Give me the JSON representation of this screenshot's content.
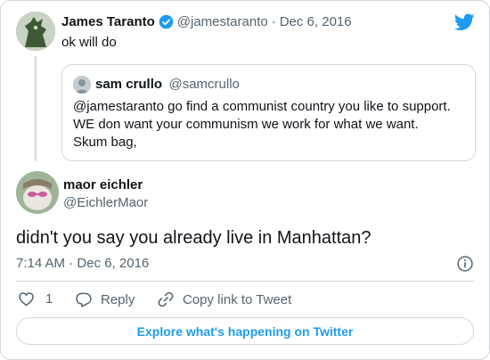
{
  "parent": {
    "name": "James Taranto",
    "handle": "@jamestaranto",
    "sep": "·",
    "date": "Dec 6, 2016",
    "text": "ok will do"
  },
  "quoted": {
    "name": "sam crullo",
    "handle": "@samcrullo",
    "text": "@jamestaranto go find a communist country you like to support. WE don want your communism we work for what we want. Skum bag,"
  },
  "reply": {
    "name": "maor eichler",
    "handle": "@EichlerMaor",
    "text": "didn't you say you already live in Manhattan?",
    "timestamp": "7:14 AM · Dec 6, 2016"
  },
  "actions": {
    "like_count": "1",
    "reply_label": "Reply",
    "copy_link_label": "Copy link to Tweet"
  },
  "footer": {
    "explore_label": "Explore what's happening on Twitter"
  },
  "colors": {
    "accent": "#1d9bf0",
    "text": "#0f1419",
    "muted": "#536471",
    "border": "#cfd9de",
    "verified": "#1d9bf0"
  },
  "icons": [
    "twitter-bird-icon",
    "verified-badge-icon",
    "info-icon",
    "heart-icon",
    "reply-icon",
    "link-icon"
  ]
}
